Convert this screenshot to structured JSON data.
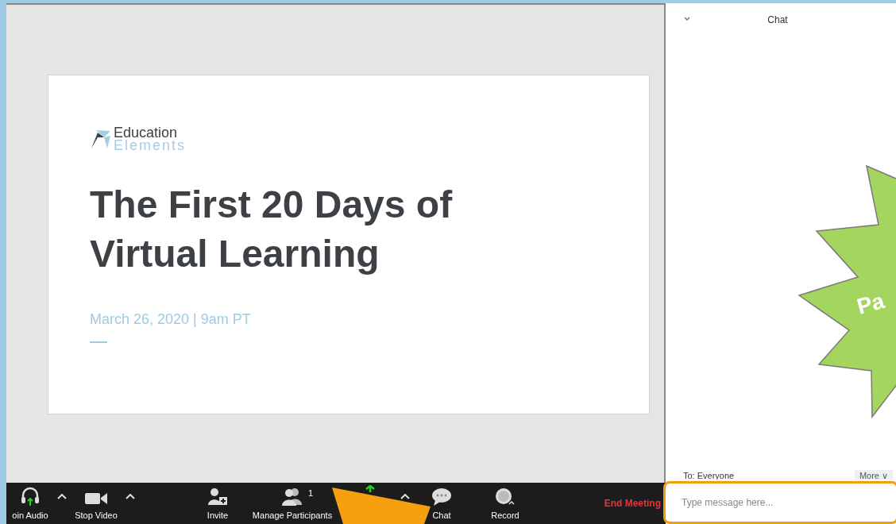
{
  "slide": {
    "logo_top": "Education",
    "logo_bottom": "Elements",
    "title": "The First 20 Days of Virtual Learning",
    "date": "March 26, 2020 | 9am PT"
  },
  "toolbar": {
    "items": [
      {
        "kind": "button",
        "label": "oin Audio"
      },
      {
        "kind": "caret"
      },
      {
        "kind": "button",
        "label": "Stop Video"
      },
      {
        "kind": "caret"
      },
      {
        "kind": "button",
        "label": "Invite"
      },
      {
        "kind": "button",
        "label": "Manage Participants",
        "count": "1"
      },
      {
        "kind": "button"
      },
      {
        "kind": "caret"
      },
      {
        "kind": "button",
        "label": "Chat"
      },
      {
        "kind": "button",
        "label": "Record"
      }
    ],
    "end_meeting": "End Meeting"
  },
  "chat": {
    "title": "Chat",
    "to": "To: Everyone",
    "more": "More ∨",
    "placeholder": "Type message here..."
  },
  "callout": {
    "text": "Pa"
  }
}
